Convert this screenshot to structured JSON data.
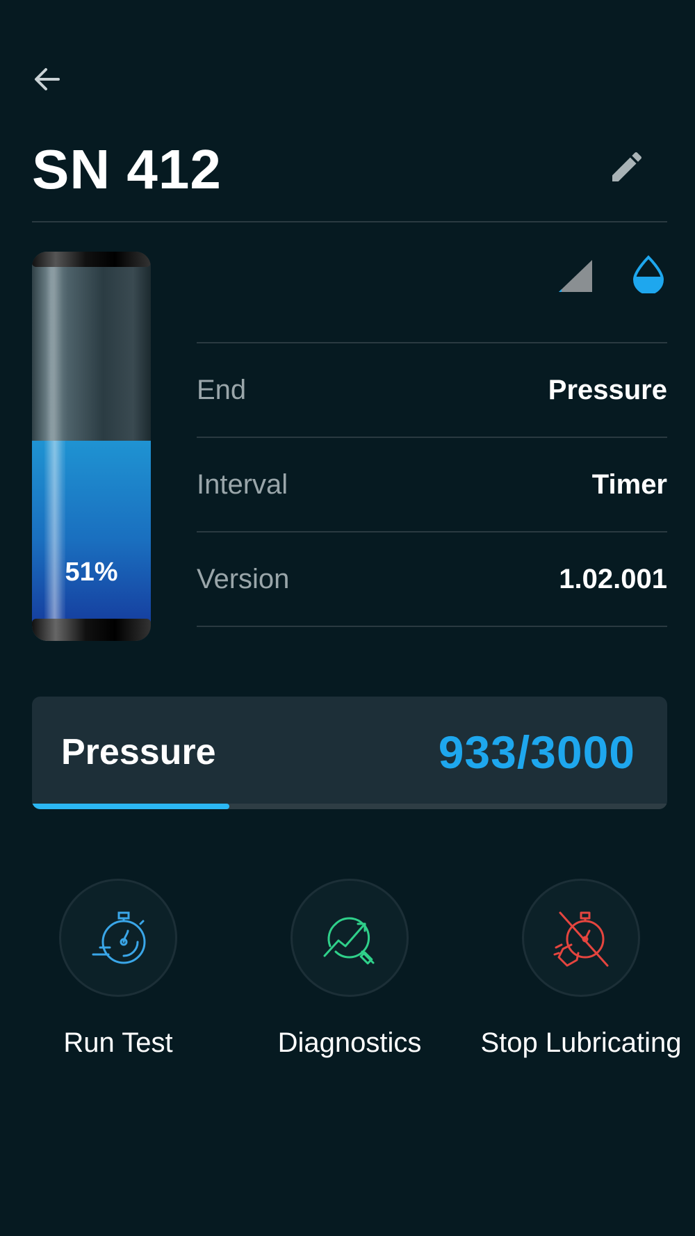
{
  "header": {
    "title": "SN 412"
  },
  "cartridge": {
    "fill_percent": 51,
    "percent_label": "51%"
  },
  "status": {
    "signal_icon": "signal-strength-icon",
    "drop_icon": "lubricant-drop-icon",
    "accent": "#1ea7ee"
  },
  "info": [
    {
      "label": "End",
      "value": "Pressure"
    },
    {
      "label": "Interval",
      "value": "Timer"
    },
    {
      "label": "Version",
      "value": "1.02.001"
    }
  ],
  "pressure": {
    "label": "Pressure",
    "value_text": "933/3000",
    "current": 933,
    "max": 3000
  },
  "actions": [
    {
      "label": "Run Test",
      "icon": "stopwatch-icon",
      "color": "#3aa6e8"
    },
    {
      "label": "Diagnostics",
      "icon": "diagnostics-chart-search-icon",
      "color": "#2fd08a"
    },
    {
      "label": "Stop Lubricating",
      "icon": "stop-lubricating-icon",
      "color": "#e5453f"
    }
  ]
}
